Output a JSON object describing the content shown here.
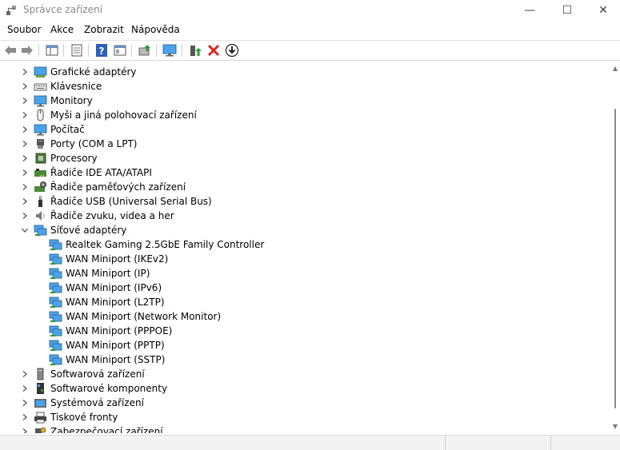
{
  "window": {
    "title": "Správce zařízení",
    "controls": {
      "minimize": "—",
      "maximize": "☐",
      "close": "✕"
    }
  },
  "menubar": {
    "items": [
      "Soubor",
      "Akce",
      "Zobrazit",
      "Nápověda"
    ]
  },
  "toolbar": {
    "buttons": [
      "back-icon",
      "forward-icon",
      "properties-grid-icon",
      "details-icon",
      "help-icon",
      "view-icon",
      "update-driver-icon",
      "monitor-icon",
      "enable-device-icon",
      "uninstall-icon",
      "download-icon"
    ]
  },
  "tree": {
    "categories": [
      {
        "label": "Grafické adaptéry",
        "icon": "display-adapter-icon",
        "expanded": false
      },
      {
        "label": "Klávesnice",
        "icon": "keyboard-icon",
        "expanded": false
      },
      {
        "label": "Monitory",
        "icon": "monitor-icon",
        "expanded": false
      },
      {
        "label": "Myši a jiná polohovací zařízení",
        "icon": "mouse-icon",
        "expanded": false
      },
      {
        "label": "Počítač",
        "icon": "computer-icon",
        "expanded": false
      },
      {
        "label": "Porty (COM a LPT)",
        "icon": "port-icon",
        "expanded": false
      },
      {
        "label": "Procesory",
        "icon": "processor-icon",
        "expanded": false
      },
      {
        "label": "Řadiče IDE ATA/ATAPI",
        "icon": "ide-controller-icon",
        "expanded": false
      },
      {
        "label": "Řadiče paměťových zařízení",
        "icon": "storage-controller-icon",
        "expanded": false
      },
      {
        "label": "Řadiče USB (Universal Serial Bus)",
        "icon": "usb-icon",
        "expanded": false
      },
      {
        "label": "Řadiče zvuku, videa a her",
        "icon": "speaker-icon",
        "expanded": false
      },
      {
        "label": "Síťové adaptéry",
        "icon": "network-adapter-icon",
        "expanded": true,
        "children": [
          "Realtek Gaming 2.5GbE Family Controller",
          "WAN Miniport (IKEv2)",
          "WAN Miniport (IP)",
          "WAN Miniport (IPv6)",
          "WAN Miniport (L2TP)",
          "WAN Miniport (Network Monitor)",
          "WAN Miniport (PPPOE)",
          "WAN Miniport (PPTP)",
          "WAN Miniport (SSTP)"
        ]
      },
      {
        "label": "Softwarová zařízení",
        "icon": "software-device-icon",
        "expanded": false
      },
      {
        "label": "Softwarové komponenty",
        "icon": "software-component-icon",
        "expanded": false
      },
      {
        "label": "Systémová zařízení",
        "icon": "system-device-icon",
        "expanded": false
      },
      {
        "label": "Tiskové fronty",
        "icon": "printer-icon",
        "expanded": false
      },
      {
        "label": "Zabezpečovací zařízení",
        "icon": "security-device-icon",
        "expanded": false
      }
    ]
  },
  "colors": {
    "accent_blue": "#2f7fd6",
    "monitor_screen": "#4aa3ea",
    "uninstall_red": "#d9241c",
    "enable_green": "#2c9a3a"
  }
}
